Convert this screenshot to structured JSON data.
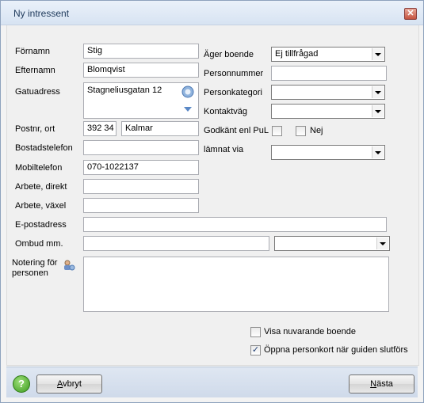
{
  "window": {
    "title": "Ny intressent",
    "close_glyph": "✕"
  },
  "form": {
    "fornamn": {
      "label": "Förnamn",
      "value": "Stig"
    },
    "efternamn": {
      "label": "Efternamn",
      "value": "Blomqvist"
    },
    "gatuadress": {
      "label": "Gatuadress",
      "value": "Stagneliusgatan 12"
    },
    "postnr": {
      "label": "Postnr, ort",
      "zip": "392 34",
      "city": "Kalmar"
    },
    "bostadstelefon": {
      "label": "Bostadstelefon",
      "value": ""
    },
    "mobiltelefon": {
      "label": "Mobiltelefon",
      "value": "070-1022137"
    },
    "arbete_direkt": {
      "label": "Arbete, direkt",
      "value": ""
    },
    "arbete_vaxel": {
      "label": "Arbete, växel",
      "value": ""
    },
    "epost": {
      "label": "E-postadress",
      "value": ""
    },
    "ombud": {
      "label": "Ombud mm.",
      "value": "",
      "select_value": ""
    },
    "notering": {
      "label_line1": "Notering för",
      "label_line2": "personen",
      "value": ""
    },
    "ager_boende": {
      "label": "Äger boende",
      "value": "Ej tillfrågad"
    },
    "personnummer": {
      "label": "Personnummer",
      "value": ""
    },
    "personkategori": {
      "label": "Personkategori",
      "value": ""
    },
    "kontaktvag": {
      "label": "Kontaktväg",
      "value": ""
    },
    "godkant": {
      "label": "Godkänt enl PuL",
      "nej_label": "Nej"
    },
    "lamnat_via": {
      "label": "lämnat via",
      "value": ""
    }
  },
  "options": {
    "visa_nuvarande": {
      "label": "Visa nuvarande boende",
      "checked": false
    },
    "oppna_personkort": {
      "label": "Öppna personkort när guiden slutförs",
      "checked": true,
      "check_glyph": "✓"
    }
  },
  "footer": {
    "help_glyph": "?",
    "cancel": {
      "label_first": "A",
      "label_rest": "vbryt"
    },
    "next": {
      "label_first": "N",
      "label_rest": "ästa"
    }
  },
  "icons": {
    "address-lookup": "globe-icon",
    "address-expand": "chevron-down-icon",
    "note-person": "person-note-icon",
    "help": "help-icon"
  }
}
